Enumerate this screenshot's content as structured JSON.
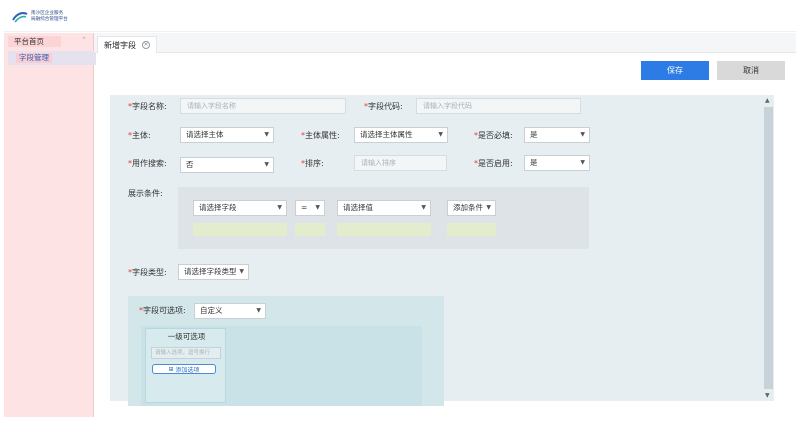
{
  "header": {
    "logo_line1": "南沙区企业服务",
    "logo_line2": "局融综合管理平台"
  },
  "sidebar": {
    "group_label": "平台首页",
    "items": [
      {
        "label": "字段管理"
      }
    ]
  },
  "tabs": [
    {
      "label": "新增字段",
      "close": "×"
    }
  ],
  "actions": {
    "save": "保存",
    "cancel": "取消"
  },
  "form": {
    "field_name": {
      "label": "字段名称:",
      "placeholder": "请输入字段名称"
    },
    "field_code": {
      "label": "字段代码:",
      "placeholder": "请输入字段代码"
    },
    "subject": {
      "label": "主体:",
      "value": "请选择主体"
    },
    "subject_attr": {
      "label": "主体属性:",
      "value": "请选择主体属性"
    },
    "required": {
      "label": "是否必填:",
      "value": "是"
    },
    "searchable": {
      "label": "用作搜索:",
      "value": "否"
    },
    "sort": {
      "label": "排序:",
      "placeholder": "请输入排序"
    },
    "enabled": {
      "label": "是否启用:",
      "value": "是"
    },
    "display_cond": {
      "label": "展示条件:",
      "field": "请选择字段",
      "operator": "=",
      "value": "请选择值",
      "add": "添加条件"
    },
    "field_type": {
      "label": "字段类型:",
      "value": "请选择字段类型"
    },
    "options": {
      "label": "字段可选项:",
      "value": "自定义",
      "level_title": "一级可选项",
      "level_placeholder": "请输入选项，逗号换行",
      "level_add": "添加选项"
    },
    "required_mark": "*"
  }
}
